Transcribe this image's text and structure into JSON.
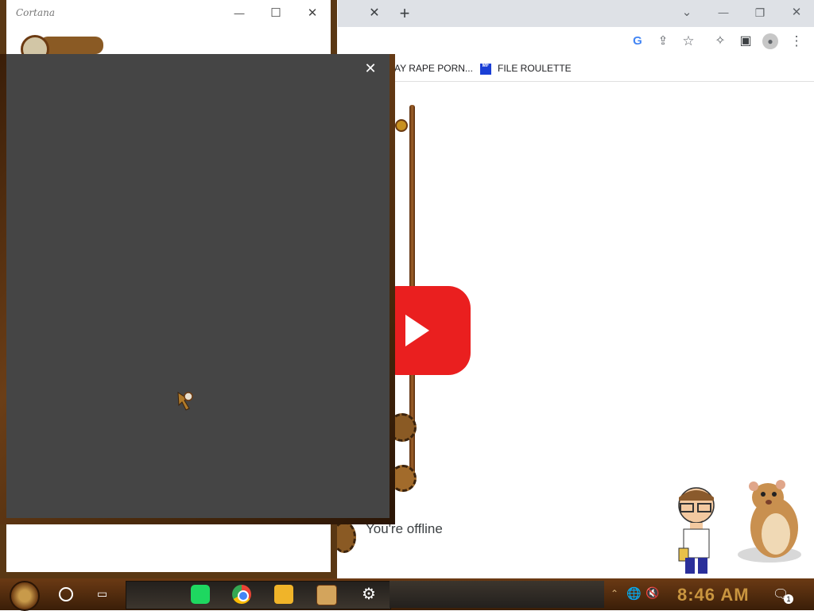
{
  "cortana_window": {
    "title": "Cortana",
    "minimize": "—",
    "maximize": "☐",
    "close": "✕"
  },
  "chrome": {
    "tab_close": "✕",
    "new_tab": "+",
    "dropdown": "⌄",
    "minimize": "—",
    "restore": "❐",
    "close": "✕",
    "toolbar_icons": {
      "google": "G",
      "share": "⇪",
      "star": "☆",
      "extensions": "✧",
      "sidepanel": "▣",
      "profile": "●",
      "menu": "⋮"
    },
    "bookmarks": [
      {
        "label": "AY RAPE PORN...",
        "icon": ""
      },
      {
        "label": "FILE ROULETTE",
        "icon": "MF"
      }
    ],
    "offline_text": "You're offline"
  },
  "popup": {
    "close": "✕"
  },
  "taskbar": {
    "taskview": "▭",
    "settings": "⚙",
    "chevron": "⌃",
    "globe": "🌐",
    "volume": "🔇",
    "clock": "8:46 AM",
    "notifications": "🗨",
    "notification_count": "1"
  },
  "colors": {
    "taskbar_top": "#6b3a14",
    "clock": "#c9953f",
    "popup_bg": "#454545",
    "youtube_red": "#ea1f1f"
  }
}
